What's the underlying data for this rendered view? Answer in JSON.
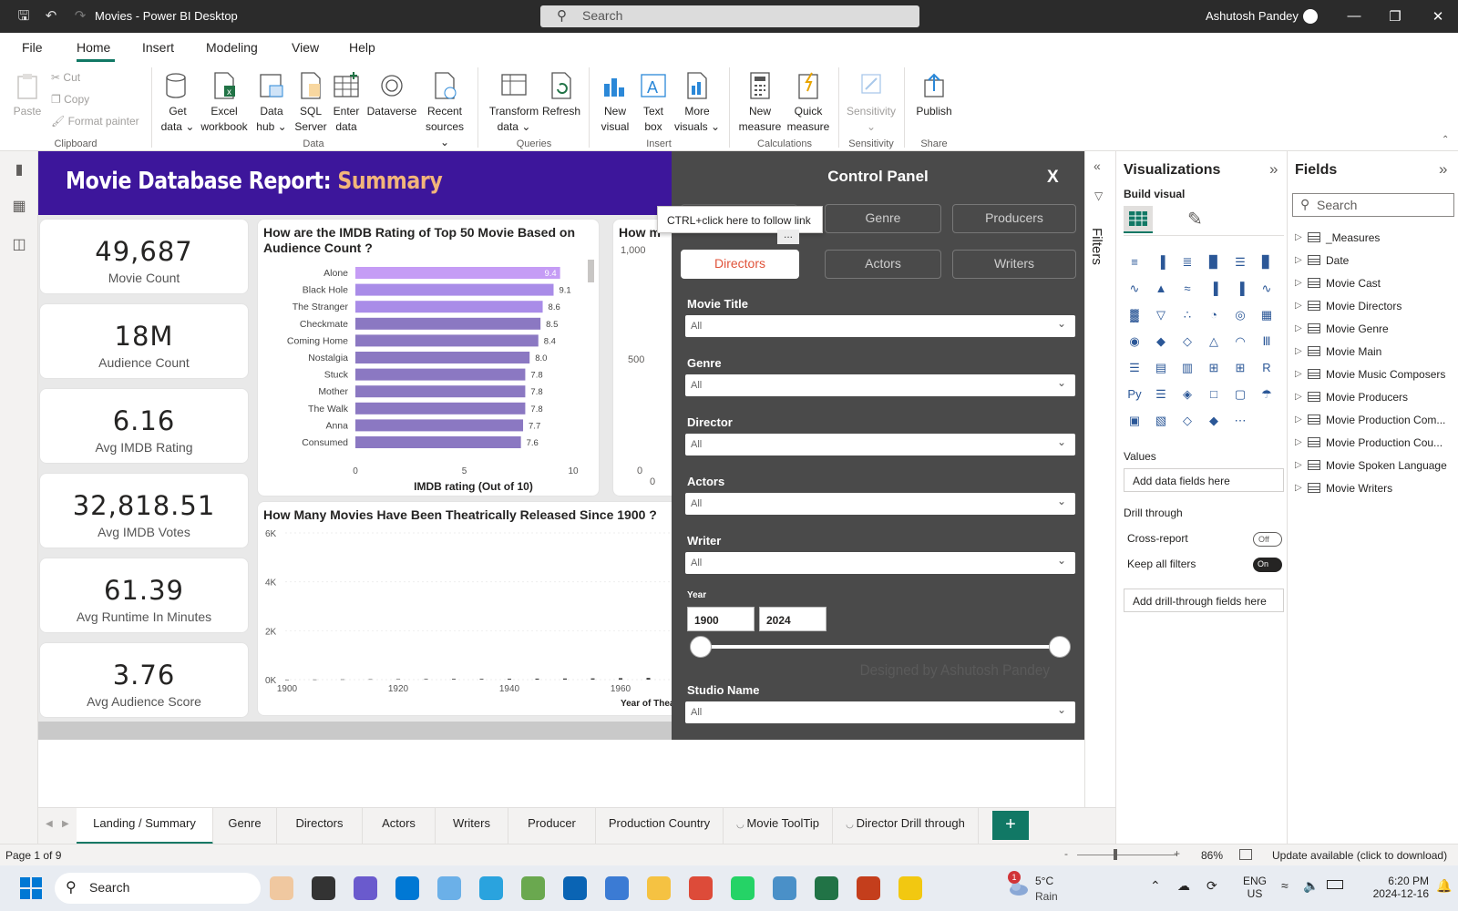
{
  "titlebar": {
    "title": "Movies - Power BI Desktop",
    "search_placeholder": "Search",
    "user": "Ashutosh Pandey"
  },
  "menu": {
    "file": "File",
    "home": "Home",
    "insert": "Insert",
    "modeling": "Modeling",
    "view": "View",
    "help": "Help"
  },
  "ribbon": {
    "paste": "Paste",
    "cut": "Cut",
    "copy": "Copy",
    "format_painter": "Format painter",
    "clipboard": "Clipboard",
    "get_data": [
      "Get",
      "data"
    ],
    "excel": [
      "Excel",
      "workbook"
    ],
    "data_hub": [
      "Data",
      "hub"
    ],
    "sql": [
      "SQL",
      "Server"
    ],
    "enter_data": [
      "Enter",
      "data"
    ],
    "dataverse": "Dataverse",
    "recent": [
      "Recent",
      "sources"
    ],
    "data_group": "Data",
    "transform": [
      "Transform",
      "data"
    ],
    "refresh": "Refresh",
    "queries": "Queries",
    "new_visual": [
      "New",
      "visual"
    ],
    "text_box": [
      "Text",
      "box"
    ],
    "more_visuals": [
      "More",
      "visuals"
    ],
    "insert_group": "Insert",
    "new_measure": [
      "New",
      "measure"
    ],
    "quick_measure": [
      "Quick",
      "measure"
    ],
    "calculations": "Calculations",
    "sensitivity": "Sensitivity",
    "sensitivity_group": "Sensitivity",
    "publish": "Publish",
    "share": "Share"
  },
  "report": {
    "title_main": "Movie Database Report: ",
    "title_accent": "Summary",
    "kpis": [
      {
        "value": "49,687",
        "label": "Movie Count"
      },
      {
        "value": "18M",
        "label": "Audience Count"
      },
      {
        "value": "6.16",
        "label": "Avg IMDB Rating"
      },
      {
        "value": "32,818.51",
        "label": "Avg IMDB Votes"
      },
      {
        "value": "61.39",
        "label": "Avg Runtime In Minutes"
      },
      {
        "value": "3.76",
        "label": "Avg Audience Score"
      }
    ],
    "partial_card_title": "How m",
    "partial_axis": [
      "1,000",
      "500",
      "0",
      "0"
    ]
  },
  "chart_data": [
    {
      "type": "bar",
      "orientation": "horizontal",
      "title": "How are the IMDB Rating of Top 50 Movie Based on Audience Count ?",
      "xlabel": "IMDB rating (Out of 10)",
      "xlim": [
        0,
        10
      ],
      "xticks": [
        "0",
        "5",
        "10"
      ],
      "categories": [
        "Alone",
        "Black Hole",
        "The Stranger",
        "Checkmate",
        "Coming Home",
        "Nostalgia",
        "Stuck",
        "Mother",
        "The Walk",
        "Anna",
        "Consumed"
      ],
      "values": [
        9.4,
        9.1,
        8.6,
        8.5,
        8.4,
        8.0,
        7.8,
        7.8,
        7.8,
        7.7,
        7.6
      ],
      "labels": [
        "9.4",
        "9.1",
        "8.6",
        "8.5",
        "8.4",
        "8.0",
        "7.8",
        "7.8",
        "7.8",
        "7.7",
        "7.6"
      ],
      "colors": {
        "high": "#c59cf5",
        "low": "#8b78c2"
      }
    },
    {
      "type": "bar",
      "title": "How Many Movies Have Been Theatrically Released Since 1900 ?",
      "xlabel": "Year of Theat",
      "ylim": [
        0,
        6000
      ],
      "yticks": [
        "6K",
        "4K",
        "2K",
        "0K"
      ],
      "xticks": [
        "1900",
        "1920",
        "1940",
        "1960"
      ],
      "x": [
        1900,
        1905,
        1910,
        1915,
        1920,
        1925,
        1930,
        1935,
        1940,
        1945,
        1950,
        1955,
        1960,
        1965
      ],
      "values": [
        0,
        5,
        10,
        15,
        20,
        25,
        30,
        30,
        35,
        40,
        45,
        50,
        60,
        70
      ]
    }
  ],
  "control_panel": {
    "title": "Control Panel",
    "close": "X",
    "tabs_row1": [
      "",
      "Genre",
      "Producers"
    ],
    "tabs_row2": [
      "Directors",
      "Actors",
      "Writers"
    ],
    "active_tab": "Directors",
    "tooltip": "CTRL+click here to follow link",
    "more": "...",
    "filters": [
      {
        "label": "Movie Title",
        "value": "All"
      },
      {
        "label": "Genre",
        "value": "All"
      },
      {
        "label": "Director",
        "value": "All"
      },
      {
        "label": "Actors",
        "value": "All"
      },
      {
        "label": "Writer",
        "value": "All"
      }
    ],
    "year_label": "Year",
    "year_from": "1900",
    "year_to": "2024",
    "studio_label": "Studio Name",
    "studio_value": "All",
    "footer": "Designed by Ashutosh Pandey"
  },
  "filters_pane": {
    "label": "Filters"
  },
  "viz_pane": {
    "title": "Visualizations",
    "build": "Build visual",
    "values": "Values",
    "values_well": "Add data fields here",
    "drill": "Drill through",
    "cross": "Cross-report",
    "cross_state": "Off",
    "keep": "Keep all filters",
    "keep_state": "On",
    "drill_well": "Add drill-through fields here"
  },
  "fields_pane": {
    "title": "Fields",
    "search": "Search",
    "tables": [
      "_Measures",
      "Date",
      "Movie Cast",
      "Movie Directors",
      "Movie Genre",
      "Movie Main",
      "Movie Music Composers",
      "Movie Producers",
      "Movie Production Com...",
      "Movie Production Cou...",
      "Movie Spoken Language",
      "Movie Writers"
    ]
  },
  "pages": [
    "Landing / Summary",
    "Genre",
    "Directors",
    "Actors",
    "Writers",
    "Producer",
    "Production Country",
    "Movie ToolTip",
    "Director Drill through"
  ],
  "status": {
    "page": "Page 1 of 9",
    "zoom": "86%",
    "update": "Update available (click to download)"
  },
  "taskbar": {
    "search": "Search",
    "weather_temp": "5°C",
    "weather_desc": "Rain",
    "weather_badge": "1",
    "lang1": "ENG",
    "lang2": "US",
    "time": "6:20 PM",
    "date": "2024-12-16"
  }
}
